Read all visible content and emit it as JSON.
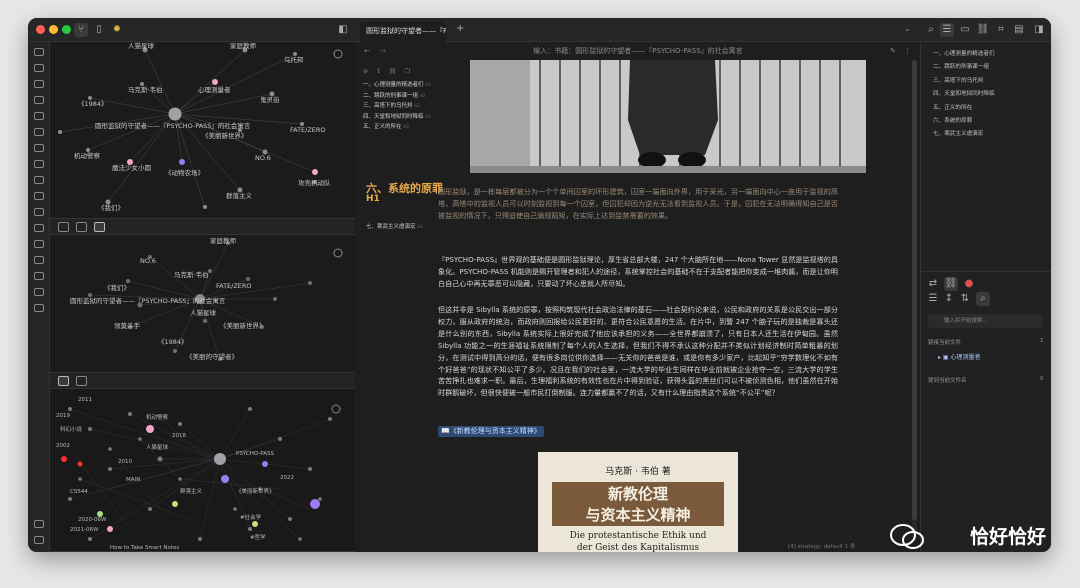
{
  "tab": {
    "title": "圆形监狱的守望者——『P…"
  },
  "breadcrumb": "输入：书籍：圆形监狱的守望者——『PSYCHO-PASS』的社会寓言",
  "toc": {
    "items": [
      "一、心理测量的精选者们",
      "二、跳跃的刑事课一组",
      "三、高塔下的乌托邦",
      "四、天堂和地狱同时降临",
      "五、正义的所在"
    ],
    "tag": "H2",
    "heading_active": "六、系统的原罪",
    "h1": "H1",
    "item7": "七、寒武主义虐演宏"
  },
  "paragraphs": [
    "圆形监狱，是一栋每层都被分为一个个单间囚室的环形建筑，囚室一端面向外界，用于采光，另一端面向中心一座用于监视的高塔，高塔中的监视人员可以时刻监视到每一个囚室，但囚犯却因为逆光无法看到监视人员。于是，囚犯在无法明确得知自己是否被监视的情况下，只得迫使自己循规蹈矩，在实际上达到监禁需要的效果。",
    "『PSYCHO-PASS』世界观的基础便是圆形监狱理论，厚生省总部大楼，247 个大脑所在地——Nona Tower 显然是监视塔的具象化。PSYCHO-PASS 机能则是赐开管理者和犯人的途径，系统掌控社会的基础不在于支配者能把你变成一堆肉酱，而是让你明白自己心中再无罪恶可以隐藏，只要动了坏心思就人所尽知。",
    "但这并非是 Sibylla 系统的原罪，按照构筑现代社会政治法律的基石——社会契约论来说，公民和政府的关系是公民交出一部分权力，服从政府的统治，而政府则回报给公民更好的、更符合公民意愿的生活。在片中，到警 247 个脑子玩的是独裁是寡头还是什么别的东西，Sibylla 系统实际上很好完成了他应该承担的义务——全世界都崩溃了，只有日本人还生活在伊甸园。虽然 Sibylla 功能之一的生涯福祉系统限制了每个人的人生选择，但我们不得不承认这种分配并不类似计划经济制时简单粗暴的划分，在测试中得到高分的话，便有很多岗位供你选择——无关你的爸爸是谁，或是你有多少家产，比起知乎“穷学数理化不如有个好爸爸”的现状不知公平了多少。况且在我们的社会里，一流大学的毕业生同样在毕业前就被企业抢夺一空，三流大学的学生苦苦挣扎也难求一职。最后，生理福利系统的有效性也在片中得到验证，获得头盔的黑丝们可以不被侦测色相，他们虽然在开始时群鹅破坏，但很快便被一般市民打倒制服。连力量都赢不了的话，又有什么理由指责这个系统“不公平”呢？"
  ],
  "link_text": "📖《新教伦理与资本主义精神》",
  "book": {
    "author": "马克斯 · 韦伯 著",
    "title_cn_1": "新教伦理",
    "title_cn_2": "与资本主义精神",
    "title_de_1": "Die protestantische Ethik und",
    "title_de_2": "der Geist des Kapitalismus"
  },
  "status": "[4]  strategy: default  1 条",
  "outline": [
    "一、心理测量的精选者们",
    "二、跳跃的刑事课一组",
    "三、高塔下的乌托邦",
    "四、天堂和地狱同时降临",
    "五、正义的所在",
    "六、系统的原罪",
    "七、寒武主义虐演宏"
  ],
  "right_bottom": {
    "filter_placeholder": "输入并开始搜索...",
    "linked_title": "链接当前文件",
    "linked_count": "1",
    "linked_item": "心理测量者",
    "unlinked_title": "提到当前文件名",
    "unlinked_count": "0"
  },
  "graph1": {
    "labels": [
      "人猫星球",
      "家庭教师",
      "乌托邦",
      "马克斯·韦伯",
      "心理测量者",
      "鬼灵街",
      "《1984》",
      "圆形监狱的守望者——『PSYCHO-PASS』的社会寓言",
      "《美丽新世界》",
      "FATE/ZERO",
      "机动警察",
      "魔法少女小圆",
      "《动物农场》",
      "NO.6",
      "攻壳机动队",
      "《我们》",
      "群落主义"
    ]
  },
  "graph2": {
    "labels": [
      "家庭教师",
      "NO.6",
      "马克斯·韦伯",
      "《我们》",
      "FATE/ZERO",
      "圆形监狱的守望者——『PSYCHO-PASS』的社会寓言",
      "人猫星球",
      "领莫杀手",
      "《美丽新世界》",
      "《1984》",
      "《美丽的守望者》"
    ]
  },
  "graph3": {
    "labels": [
      "2011",
      "2019",
      "2002",
      "科幻小说",
      "机动警察",
      "人猫星球",
      "2018",
      "PSYCHO-PASS",
      "2010",
      "MAIN",
      "《美丽新世界》",
      "CS544",
      "群落主义",
      "2020-06W",
      "2021-06W",
      "2022",
      "How to Take Smart Notes",
      "#社会学",
      "#哲学"
    ]
  },
  "watermark": "恰好恰好"
}
